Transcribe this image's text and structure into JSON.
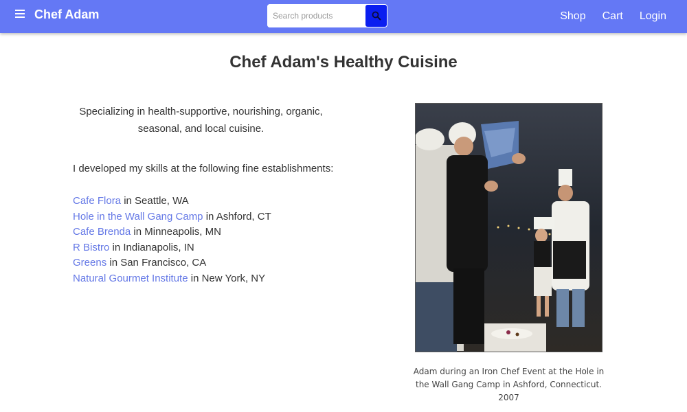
{
  "navbar": {
    "brand": "Chef Adam",
    "search_placeholder": "Search products",
    "links": [
      "Shop",
      "Cart",
      "Login"
    ]
  },
  "page": {
    "title": "Chef Adam's Healthy Cuisine",
    "intro": "Specializing in health-supportive, nourishing, organic, seasonal, and local cuisine.",
    "skills_intro": "I developed my skills at the following fine establishments:",
    "establishments": [
      {
        "name": "Cafe Flora",
        "location": " in Seattle, WA"
      },
      {
        "name": "Hole in the Wall Gang Camp",
        "location": " in Ashford, CT"
      },
      {
        "name": "Cafe Brenda",
        "location": " in Minneapolis, MN"
      },
      {
        "name": "R Bistro",
        "location": " in Indianapolis, IN"
      },
      {
        "name": "Greens",
        "location": " in San Francisco, CA"
      },
      {
        "name": "Natural Gourmet Institute",
        "location": " in New York, NY"
      }
    ],
    "caption": "Adam during an Iron Chef Event at the Hole in the Wall Gang Camp in Ashford, Connecticut. 2007"
  },
  "colors": {
    "navbar": "#6478f5",
    "search_button": "#0a1ef0",
    "link": "#6478e6"
  },
  "icons": {
    "menu": "hamburger-menu-icon",
    "search": "search-icon"
  }
}
